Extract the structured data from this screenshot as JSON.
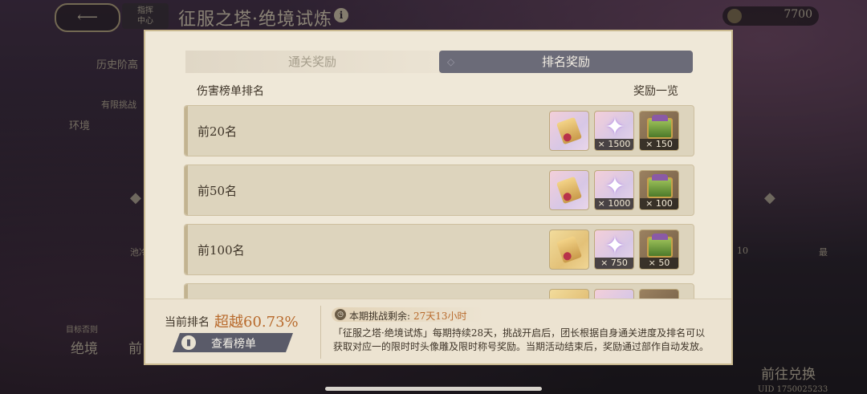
{
  "header": {
    "back_icon": "back-arrow-icon",
    "home_label": "指挥\n中心",
    "title": "征服之塔·绝境试炼",
    "info_icon": "i",
    "currency_value": "7700"
  },
  "background": {
    "history_label": "历史阶高",
    "env_badge": "有限挑战",
    "env_label": "环境",
    "target_small": "目标否则",
    "target_big": "绝境",
    "front_label": "前",
    "go_redeem": "前往兑换",
    "uid": "UID 1750025233",
    "left_stub": "池冷",
    "right_stub": "10",
    "right_stub2": "最"
  },
  "modal": {
    "tabs": [
      {
        "label": "通关奖励",
        "active": false
      },
      {
        "label": "排名奖励",
        "active": true
      }
    ],
    "col_left": "伤害榜单排名",
    "col_right": "奖励一览",
    "rows": [
      {
        "label": "前20名",
        "items": [
          {
            "icon": "scroll-icon",
            "frame": "pink",
            "qty": ""
          },
          {
            "icon": "star-crystal-icon",
            "frame": "pink",
            "qty": "× 1500"
          },
          {
            "icon": "chest-icon",
            "frame": "brown",
            "qty": "× 150"
          }
        ]
      },
      {
        "label": "前50名",
        "items": [
          {
            "icon": "scroll-icon",
            "frame": "pink",
            "qty": ""
          },
          {
            "icon": "star-crystal-icon",
            "frame": "pink",
            "qty": "× 1000"
          },
          {
            "icon": "chest-icon",
            "frame": "brown",
            "qty": "× 100"
          }
        ]
      },
      {
        "label": "前100名",
        "items": [
          {
            "icon": "scroll-icon",
            "frame": "gold",
            "qty": ""
          },
          {
            "icon": "star-crystal-icon",
            "frame": "pink",
            "qty": "× 750"
          },
          {
            "icon": "chest-icon",
            "frame": "brown",
            "qty": "× 50"
          }
        ]
      }
    ],
    "footer": {
      "current_rank_label": "当前排名",
      "current_rank_value": "超越60.73%",
      "view_button": "查看榜单",
      "timer_label": "本期挑战剩余:",
      "timer_value": "27天13小时",
      "description": "「征服之塔·绝境试炼」每期持续28天，挑战开启后，团长根据自身通关进度及排名可以获取对应一的限时时头像雕及限时称号奖励。当期活动结束后，奖励通过部作自动发放。"
    }
  },
  "colors": {
    "accent_orange": "#b86a2c",
    "tab_active": "#6b6b78",
    "modal_bg": "#efe8d8"
  }
}
